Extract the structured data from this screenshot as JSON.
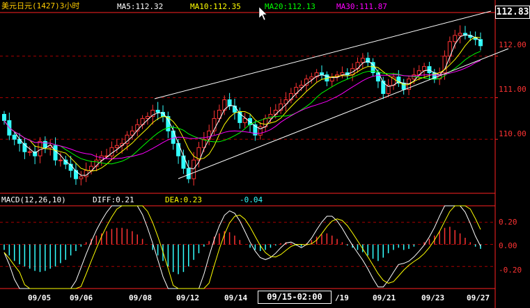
{
  "header": {
    "title": "美元日元(1427)3小时",
    "ma5": "MA5:112.32",
    "ma10": "MA10:112.35",
    "ma20": "MA20:112.13",
    "ma30": "MA30:111.87",
    "last_price": "112.83"
  },
  "macd_header": {
    "name": "MACD(12,26,10)",
    "diff": "DIFF:0.21",
    "dea": "DEA:0.23",
    "macd": "-0.04"
  },
  "x_labels": [
    "09/05",
    "09/06",
    "09/08",
    "09/12",
    "09/14",
    "/19",
    "09/21",
    "09/23",
    "09/27"
  ],
  "cursor_label": "09/15-02:00",
  "colors": {
    "up": "#ff3333",
    "down": "#33ffff",
    "ma5": "#ffffff",
    "ma10": "#ffff00",
    "ma20": "#00ff00",
    "ma30": "#ff00ff",
    "grid": "#aa0000",
    "axis": "#ff2222"
  },
  "chart_data": [
    {
      "type": "candlestick",
      "title": "美元日元(1427)3小时",
      "y_ticks": [
        "112.00",
        "111.00",
        "110.00"
      ],
      "ylim": [
        108.7,
        113.05
      ],
      "x": [
        "09/05",
        "09/06",
        "09/08",
        "09/12",
        "09/14",
        "09/19",
        "09/21",
        "09/23",
        "09/27"
      ],
      "series": [
        {
          "name": "MA5",
          "value": 112.32
        },
        {
          "name": "MA10",
          "value": 112.35
        },
        {
          "name": "MA20",
          "value": 112.13
        },
        {
          "name": "MA30",
          "value": 111.87
        }
      ],
      "close": [
        110.45,
        110.1,
        110.0,
        109.9,
        109.7,
        109.7,
        109.6,
        109.95,
        109.8,
        109.85,
        109.5,
        109.5,
        109.4,
        109.25,
        109.05,
        109.1,
        109.25,
        109.35,
        109.5,
        109.6,
        109.6,
        109.8,
        109.85,
        109.9,
        110.1,
        110.2,
        110.35,
        110.5,
        110.55,
        110.7,
        110.65,
        110.55,
        110.2,
        109.9,
        109.6,
        109.3,
        109.05,
        109.5,
        109.8,
        110.0,
        110.2,
        110.5,
        110.7,
        110.95,
        110.8,
        110.65,
        110.4,
        110.5,
        110.35,
        110.1,
        110.3,
        110.5,
        110.6,
        110.7,
        110.85,
        110.95,
        111.1,
        111.25,
        111.3,
        111.45,
        111.5,
        111.6,
        111.55,
        111.4,
        111.5,
        111.55,
        111.6,
        111.55,
        111.7,
        111.85,
        111.95,
        111.85,
        111.6,
        111.4,
        111.1,
        111.3,
        111.5,
        111.35,
        111.2,
        111.45,
        111.55,
        111.65,
        111.75,
        111.6,
        111.45,
        111.6,
        112.0,
        112.35,
        112.5,
        112.55,
        112.5,
        112.45,
        112.4,
        112.25
      ],
      "high_extremes": {
        "max": 112.85,
        "min": 108.95
      }
    },
    {
      "type": "bar",
      "title": "MACD(12,26,10)",
      "series": [
        {
          "name": "DIFF",
          "value": 0.21
        },
        {
          "name": "DEA",
          "value": 0.23
        },
        {
          "name": "MACD",
          "value": -0.04
        }
      ],
      "y_ticks": [
        "0.20",
        "0.00",
        "-0.20"
      ],
      "ylim": [
        -0.4,
        0.35
      ],
      "values": [
        -0.05,
        -0.1,
        -0.15,
        -0.18,
        -0.2,
        -0.22,
        -0.24,
        -0.25,
        -0.24,
        -0.22,
        -0.2,
        -0.17,
        -0.14,
        -0.1,
        -0.06,
        -0.02,
        0.02,
        0.05,
        0.08,
        0.1,
        0.12,
        0.14,
        0.15,
        0.15,
        0.14,
        0.12,
        0.09,
        0.05,
        0.0,
        -0.05,
        -0.1,
        -0.15,
        -0.2,
        -0.25,
        -0.27,
        -0.25,
        -0.2,
        -0.14,
        -0.08,
        -0.02,
        0.03,
        0.07,
        0.1,
        0.12,
        0.11,
        0.08,
        0.04,
        0.0,
        -0.03,
        -0.05,
        -0.06,
        -0.05,
        -0.03,
        -0.01,
        0.01,
        0.02,
        0.01,
        -0.01,
        -0.02,
        0.01,
        0.04,
        0.07,
        0.09,
        0.1,
        0.08,
        0.05,
        0.02,
        -0.01,
        -0.03,
        -0.05,
        -0.07,
        -0.1,
        -0.13,
        -0.15,
        -0.12,
        -0.08,
        -0.05,
        -0.03,
        -0.05,
        -0.04,
        -0.02,
        0.0,
        0.02,
        0.05,
        0.08,
        0.12,
        0.15,
        0.16,
        0.13,
        0.1,
        0.06,
        0.02,
        -0.02,
        -0.04
      ]
    }
  ]
}
